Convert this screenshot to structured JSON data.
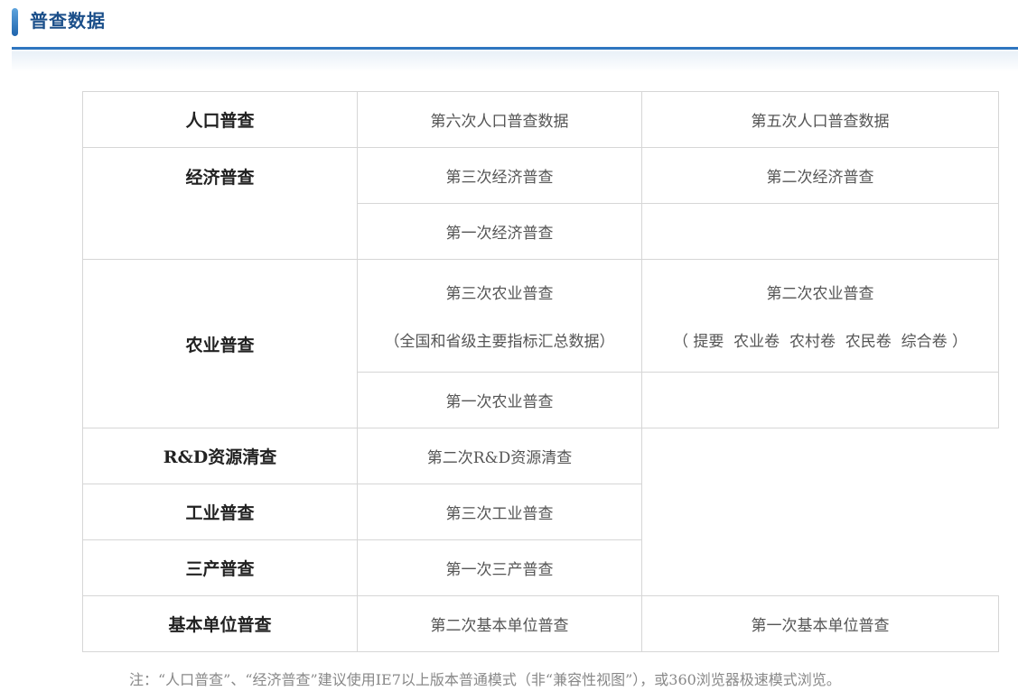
{
  "header": {
    "title": "普查数据"
  },
  "rows": {
    "population": {
      "category": "人口普查",
      "c1": "第六次人口普查数据",
      "c2": "第五次人口普查数据"
    },
    "economy": {
      "category": "经济普查",
      "c1": "第三次经济普查",
      "c2": "第二次经济普查",
      "c3": "第一次经济普查"
    },
    "agriculture": {
      "category": "农业普查",
      "c1": "第三次农业普查",
      "c1_note": "（全国和省级主要指标汇总数据）",
      "c2": "第二次农业普查",
      "c2_note": "（ 提要  农业卷  农村卷  农民卷  综合卷 ）",
      "c3": "第一次农业普查"
    },
    "rd": {
      "category": "R&D资源清查",
      "c1": "第二次R&D资源清查"
    },
    "industry": {
      "category": "工业普查",
      "c1": "第三次工业普查"
    },
    "tertiary": {
      "category": "三产普查",
      "c1": "第一次三产普查"
    },
    "basic_unit": {
      "category": "基本单位普查",
      "c1": "第二次基本单位普查",
      "c2": "第一次基本单位普查"
    }
  },
  "footnote": "注：“人口普查”、“经济普查”建议使用IE7以上版本普通模式（非“兼容性视图”），或360浏览器极速模式浏览。"
}
